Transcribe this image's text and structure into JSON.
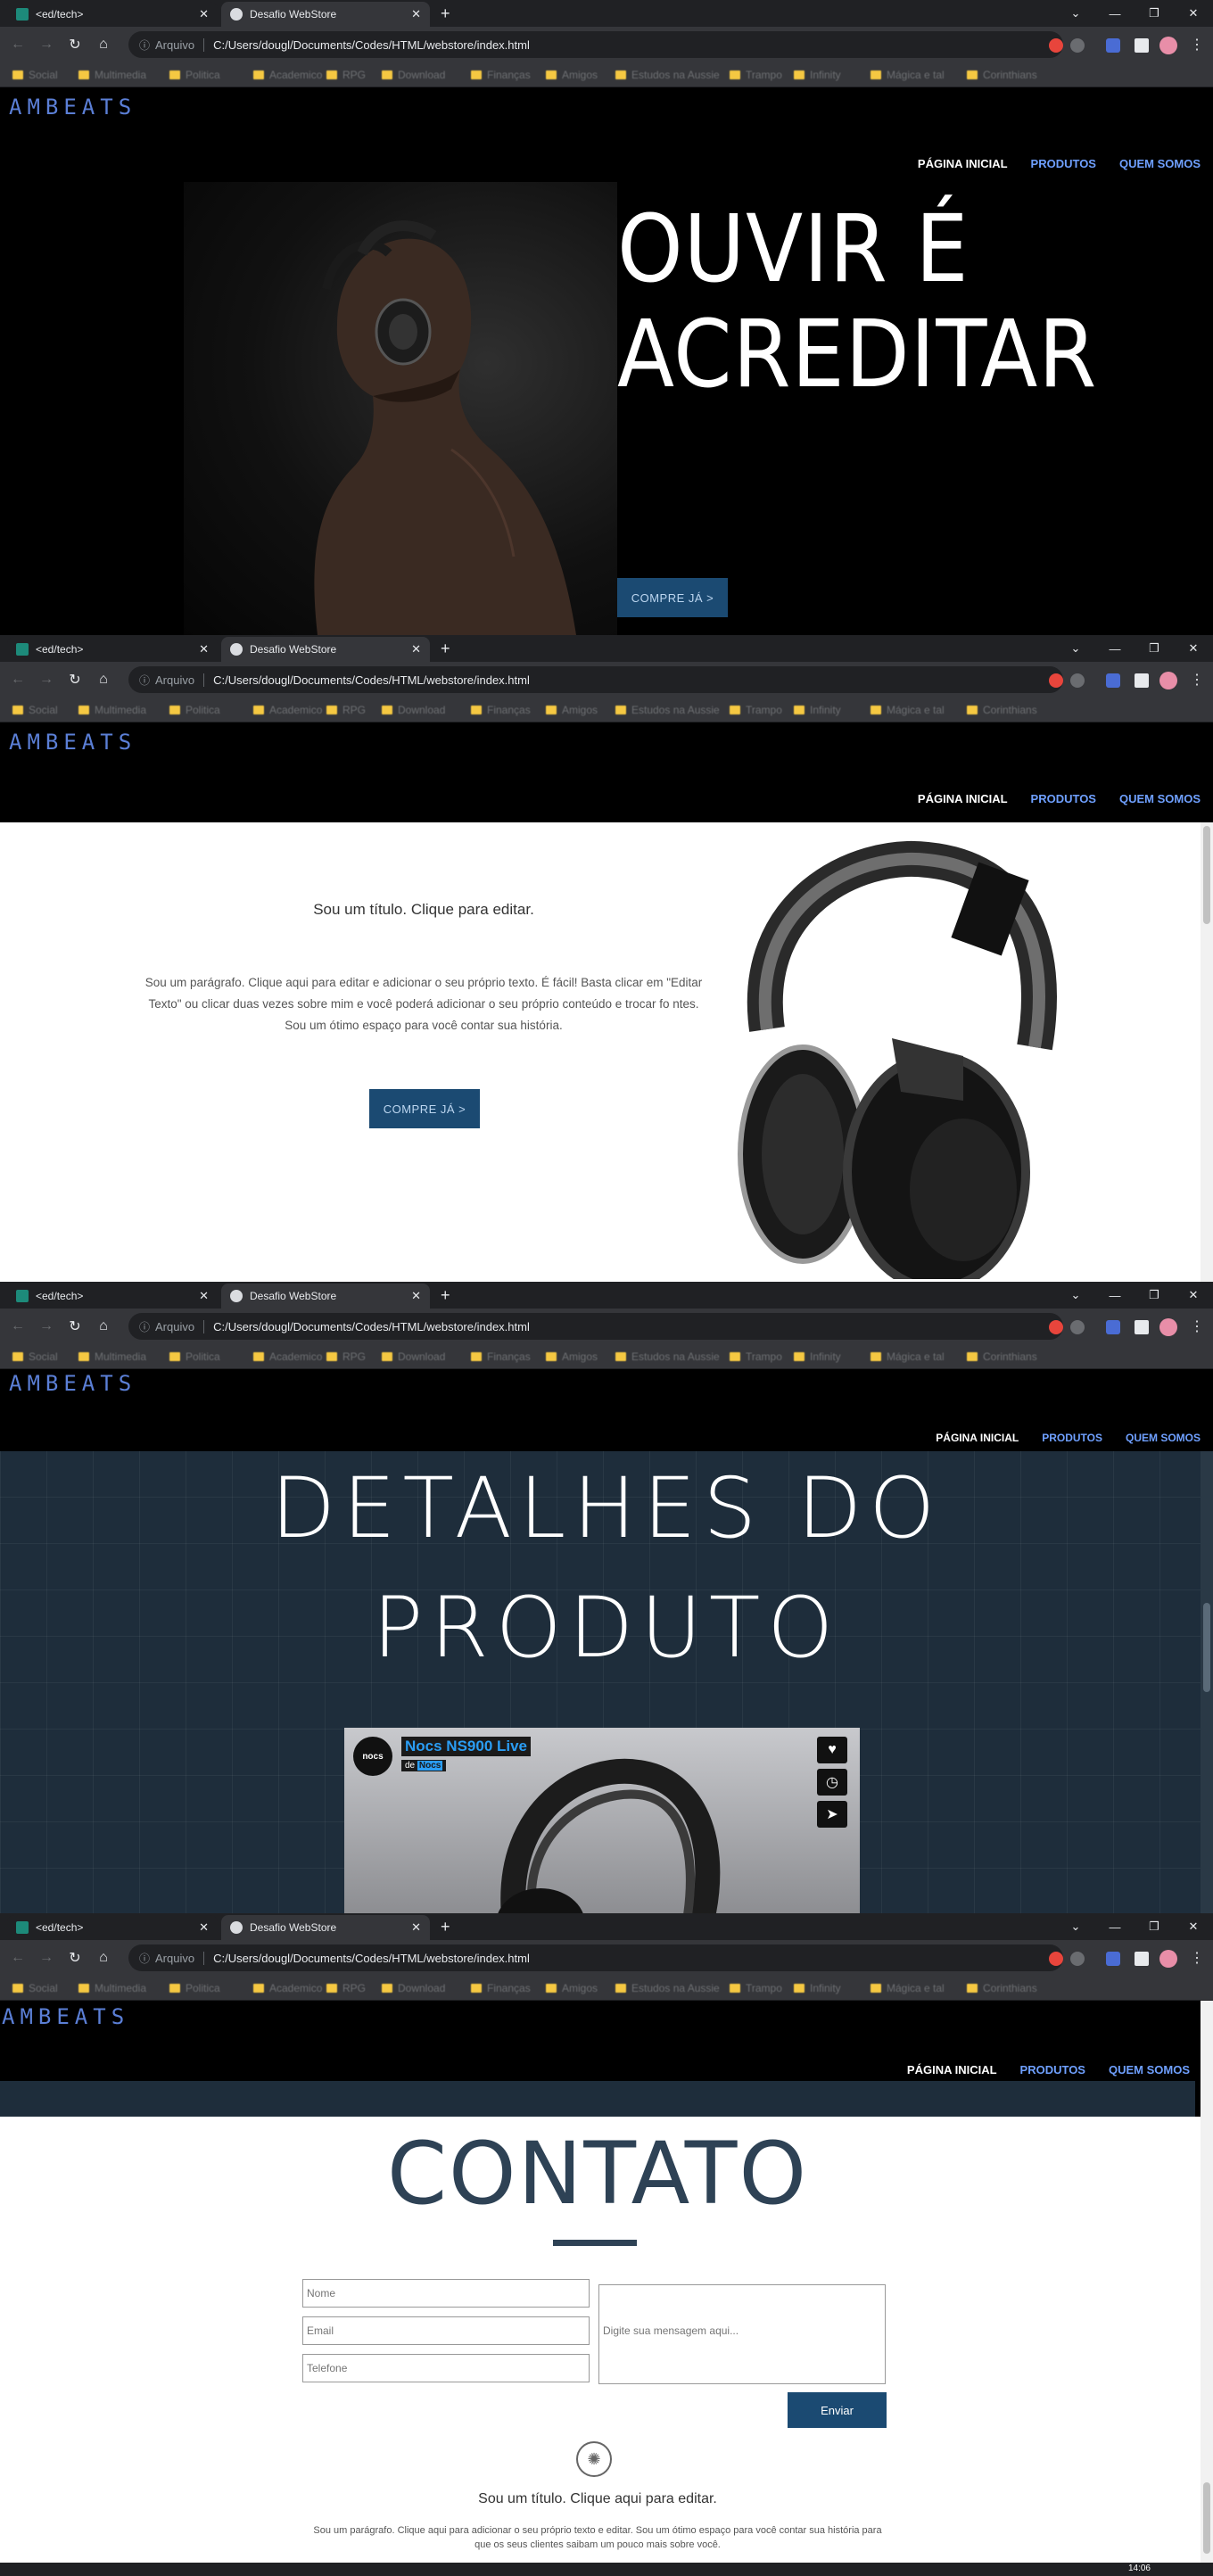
{
  "browser": {
    "tab_inactive": "<ed/tech>",
    "tab_active": "Desafio WebStore",
    "scheme": "Arquivo",
    "url": "C:/Users/dougl/Documents/Codes/HTML/webstore/index.html",
    "bookmarks": [
      "Social",
      "Multimedia",
      "Politica",
      "Academico",
      "RPG",
      "Download",
      "Finanças",
      "Amigos",
      "Estudos na Aussie",
      "Trampo",
      "Infinity",
      "Mágica e tal",
      "Corinthians"
    ]
  },
  "site": {
    "logo": "AMBEATS",
    "nav": [
      "PÁGINA INICIAL",
      "PRODUTOS",
      "QUEM SOMOS"
    ]
  },
  "hero": {
    "title_line1": "OUVIR É",
    "title_line2": "ACREDITAR",
    "cta": "COMPRE JÁ >"
  },
  "about": {
    "title": "Sou um título. Clique para editar.",
    "paragraph": "Sou um parágrafo. Clique aqui para editar e adicionar o seu próprio texto. É fácil! Basta clicar em \"Editar Texto\" ou clicar duas vezes sobre mim e você poderá adicionar o seu próprio conteúdo e trocar fo ntes. Sou um ótimo espaço para você contar sua história.",
    "cta": "COMPRE JÁ >"
  },
  "details": {
    "title_line1": "DETALHES DO",
    "title_line2": "PRODUTO",
    "video_logo": "nocs",
    "video_title": "Nocs NS900 Live",
    "video_by": "de",
    "video_channel": "Nocs"
  },
  "contact": {
    "title": "CONTATO",
    "name_placeholder": "Nome",
    "email_placeholder": "Email",
    "phone_placeholder": "Telefone",
    "message_placeholder": "Digite sua mensagem aqui...",
    "submit": "Enviar",
    "footer_title": "Sou um título. Clique aqui para editar.",
    "footer_para": "Sou um parágrafo. Clique aqui para adicionar o seu próprio texto e editar. Sou um ótimo espaço para você contar sua história para que os seus clientes saibam um pouco mais sobre você."
  },
  "clock": "14:06"
}
